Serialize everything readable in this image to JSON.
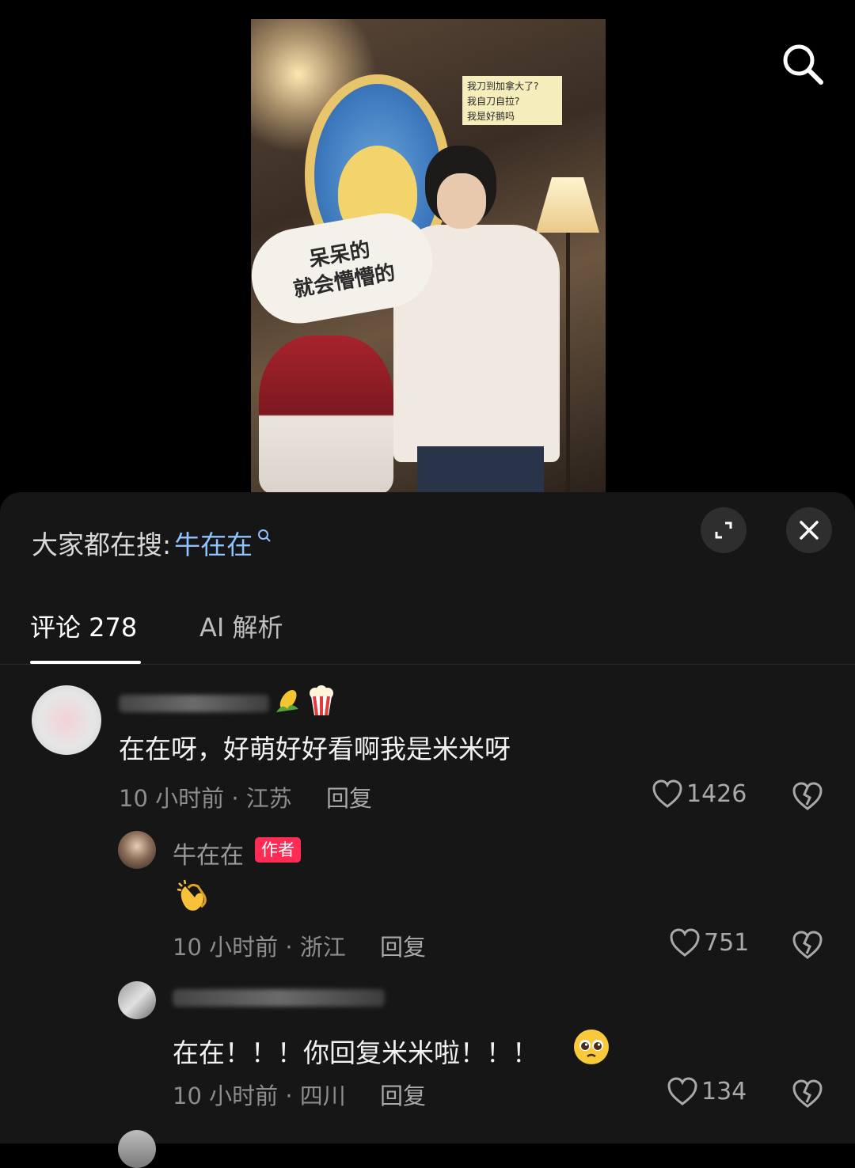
{
  "video": {
    "note_lines": [
      "我刀到加拿大了?",
      "我自刀自拉?",
      "我是好鹅吗"
    ],
    "bubble_lines": [
      "呆呆的",
      "就会懵懵的"
    ]
  },
  "sheet": {
    "search_prefix": "大家都在搜:",
    "search_keyword": "牛在在",
    "tabs": [
      {
        "label": "评论 278",
        "active": true
      },
      {
        "label": "AI 解析",
        "active": false
      }
    ]
  },
  "comments": [
    {
      "text": "在在呀，好萌好好看啊我是米米呀",
      "meta": "10 小时前 · 江苏",
      "reply_label": "回复",
      "likes": "1426"
    },
    {
      "author": "牛在在",
      "badge": "作者",
      "meta": "10 小时前 · 浙江",
      "reply_label": "回复",
      "likes": "751"
    },
    {
      "text": "在在！！！你回复米米啦！！！",
      "meta": "10 小时前 · 四川",
      "reply_label": "回复",
      "likes": "134"
    }
  ],
  "colors": {
    "accent": "#fe2c55",
    "keyword": "#8fc3ff",
    "sheet_bg": "#161616"
  }
}
